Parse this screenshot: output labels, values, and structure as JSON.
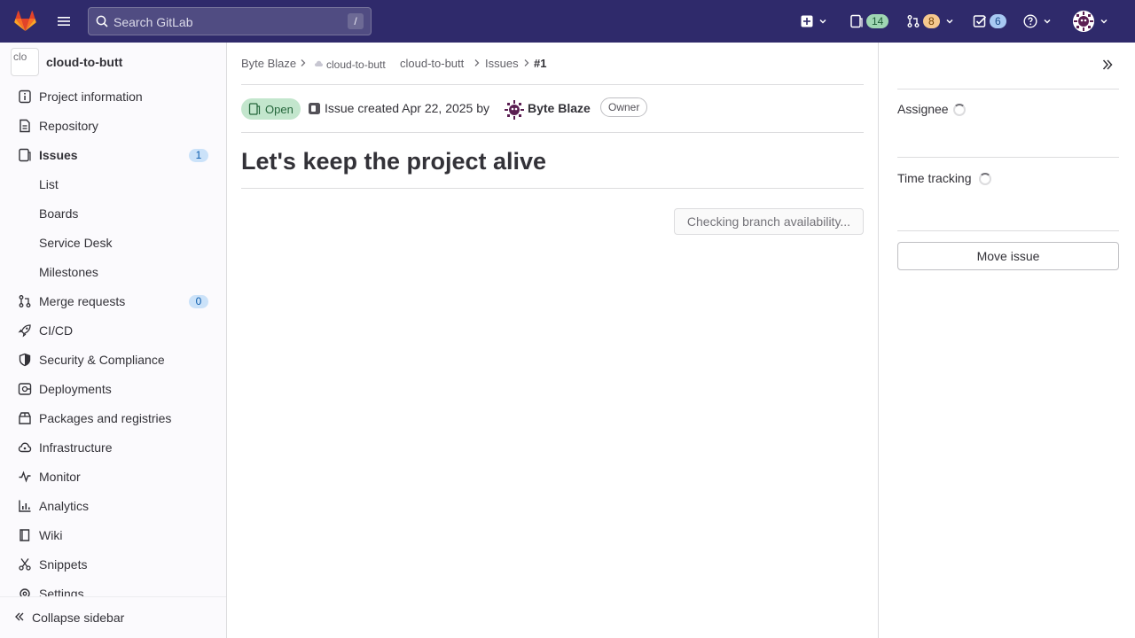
{
  "topbar": {
    "search_placeholder": "Search GitLab",
    "search_shortcut": "/",
    "issues_count": "14",
    "merge_requests_count": "8",
    "todos_count": "6",
    "icons": [
      "gitlab-logo",
      "hamburger-menu-icon",
      "search-icon",
      "plus-square-icon",
      "issues-icon",
      "merge-request-icon",
      "todo-icon",
      "help-icon",
      "user-avatar"
    ]
  },
  "sidebar": {
    "project_avatar_alt": "clo",
    "project_name": "cloud-to-butt",
    "items": [
      {
        "label": "Project information",
        "icon": "info-icon"
      },
      {
        "label": "Repository",
        "icon": "document-icon"
      },
      {
        "label": "Issues",
        "icon": "issues-icon",
        "count": "1",
        "active": true
      },
      {
        "label": "List",
        "sub": true
      },
      {
        "label": "Boards",
        "sub": true
      },
      {
        "label": "Service Desk",
        "sub": true
      },
      {
        "label": "Milestones",
        "sub": true
      },
      {
        "label": "Merge requests",
        "icon": "merge-request-icon",
        "count": "0"
      },
      {
        "label": "CI/CD",
        "icon": "rocket-icon"
      },
      {
        "label": "Security & Compliance",
        "icon": "shield-icon"
      },
      {
        "label": "Deployments",
        "icon": "deployments-icon"
      },
      {
        "label": "Packages and registries",
        "icon": "package-icon"
      },
      {
        "label": "Infrastructure",
        "icon": "cloud-icon"
      },
      {
        "label": "Monitor",
        "icon": "monitor-icon"
      },
      {
        "label": "Analytics",
        "icon": "chart-icon"
      },
      {
        "label": "Wiki",
        "icon": "book-icon"
      },
      {
        "label": "Snippets",
        "icon": "scissors-icon"
      },
      {
        "label": "Settings",
        "icon": "settings-icon"
      }
    ],
    "collapse_label": "Collapse sidebar"
  },
  "breadcrumb": {
    "owner": "Byte Blaze",
    "project_image_alt": "cloud-to-butt",
    "project": "cloud-to-butt",
    "section": "Issues",
    "issue": "#1"
  },
  "issue": {
    "status": "Open",
    "created_text": "Issue created Apr 22, 2025 by",
    "author": "Byte Blaze",
    "author_role": "Owner",
    "title": "Let's keep the project alive",
    "branch_button": "Checking branch availability..."
  },
  "right_sidebar": {
    "assignee_label": "Assignee",
    "time_tracking_label": "Time tracking",
    "move_issue_label": "Move issue"
  },
  "colors": {
    "topbar_bg": "#2f2a6b",
    "open_status_bg": "#c3e6cd",
    "open_status_text": "#24663b"
  }
}
